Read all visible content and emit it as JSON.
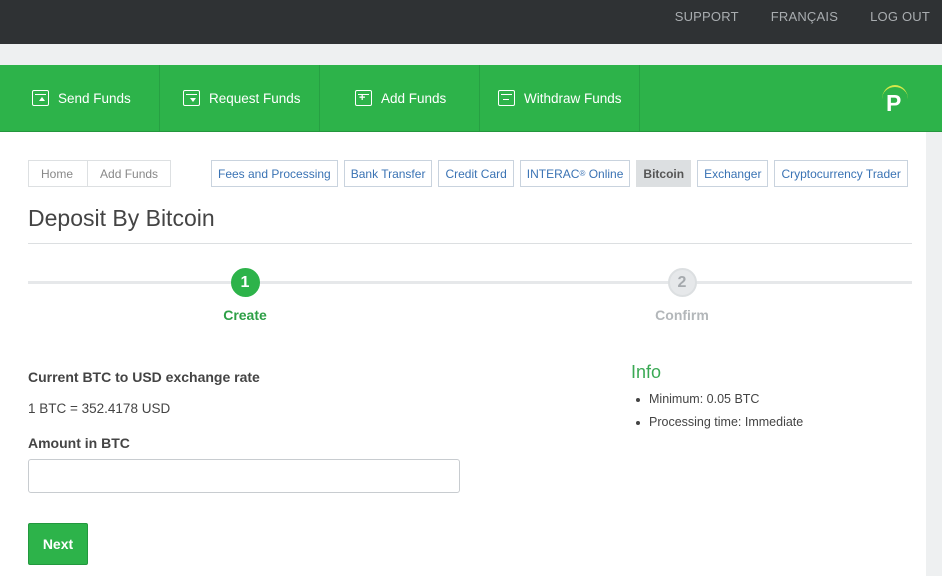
{
  "topbar": {
    "links": [
      "SUPPORT",
      "FRANÇAIS",
      "LOG OUT"
    ]
  },
  "nav": {
    "items": [
      {
        "label": "Send Funds",
        "icon": "send-funds-icon"
      },
      {
        "label": "Request Funds",
        "icon": "request-funds-icon"
      },
      {
        "label": "Add Funds",
        "icon": "add-funds-icon"
      },
      {
        "label": "Withdraw Funds",
        "icon": "withdraw-funds-icon"
      }
    ],
    "logo_letter": "P"
  },
  "breadcrumb": {
    "home": "Home",
    "current": "Add Funds"
  },
  "tabs": {
    "fees": "Fees and Processing",
    "bank": "Bank Transfer",
    "card": "Credit Card",
    "interac": "INTERAC",
    "interac_mark": "®",
    "interac_suffix": " Online",
    "bitcoin": "Bitcoin",
    "exchanger": "Exchanger",
    "crypto": "Cryptocurrency Trader"
  },
  "page": {
    "title": "Deposit By Bitcoin"
  },
  "steps": {
    "step1_num": "1",
    "step1_label": "Create",
    "step2_num": "2",
    "step2_label": "Confirm"
  },
  "form": {
    "rate_label": "Current BTC to USD exchange rate",
    "rate_value": "1 BTC = 352.4178 USD",
    "amount_label": "Amount in BTC",
    "amount_value": "",
    "next_label": "Next"
  },
  "info": {
    "title": "Info",
    "minimum": "Minimum: 0.05 BTC",
    "processing": "Processing time: Immediate"
  },
  "colors": {
    "brand_green": "#2db34a",
    "topbar_dark": "#2f3234",
    "link_blue": "#3a73b4"
  }
}
